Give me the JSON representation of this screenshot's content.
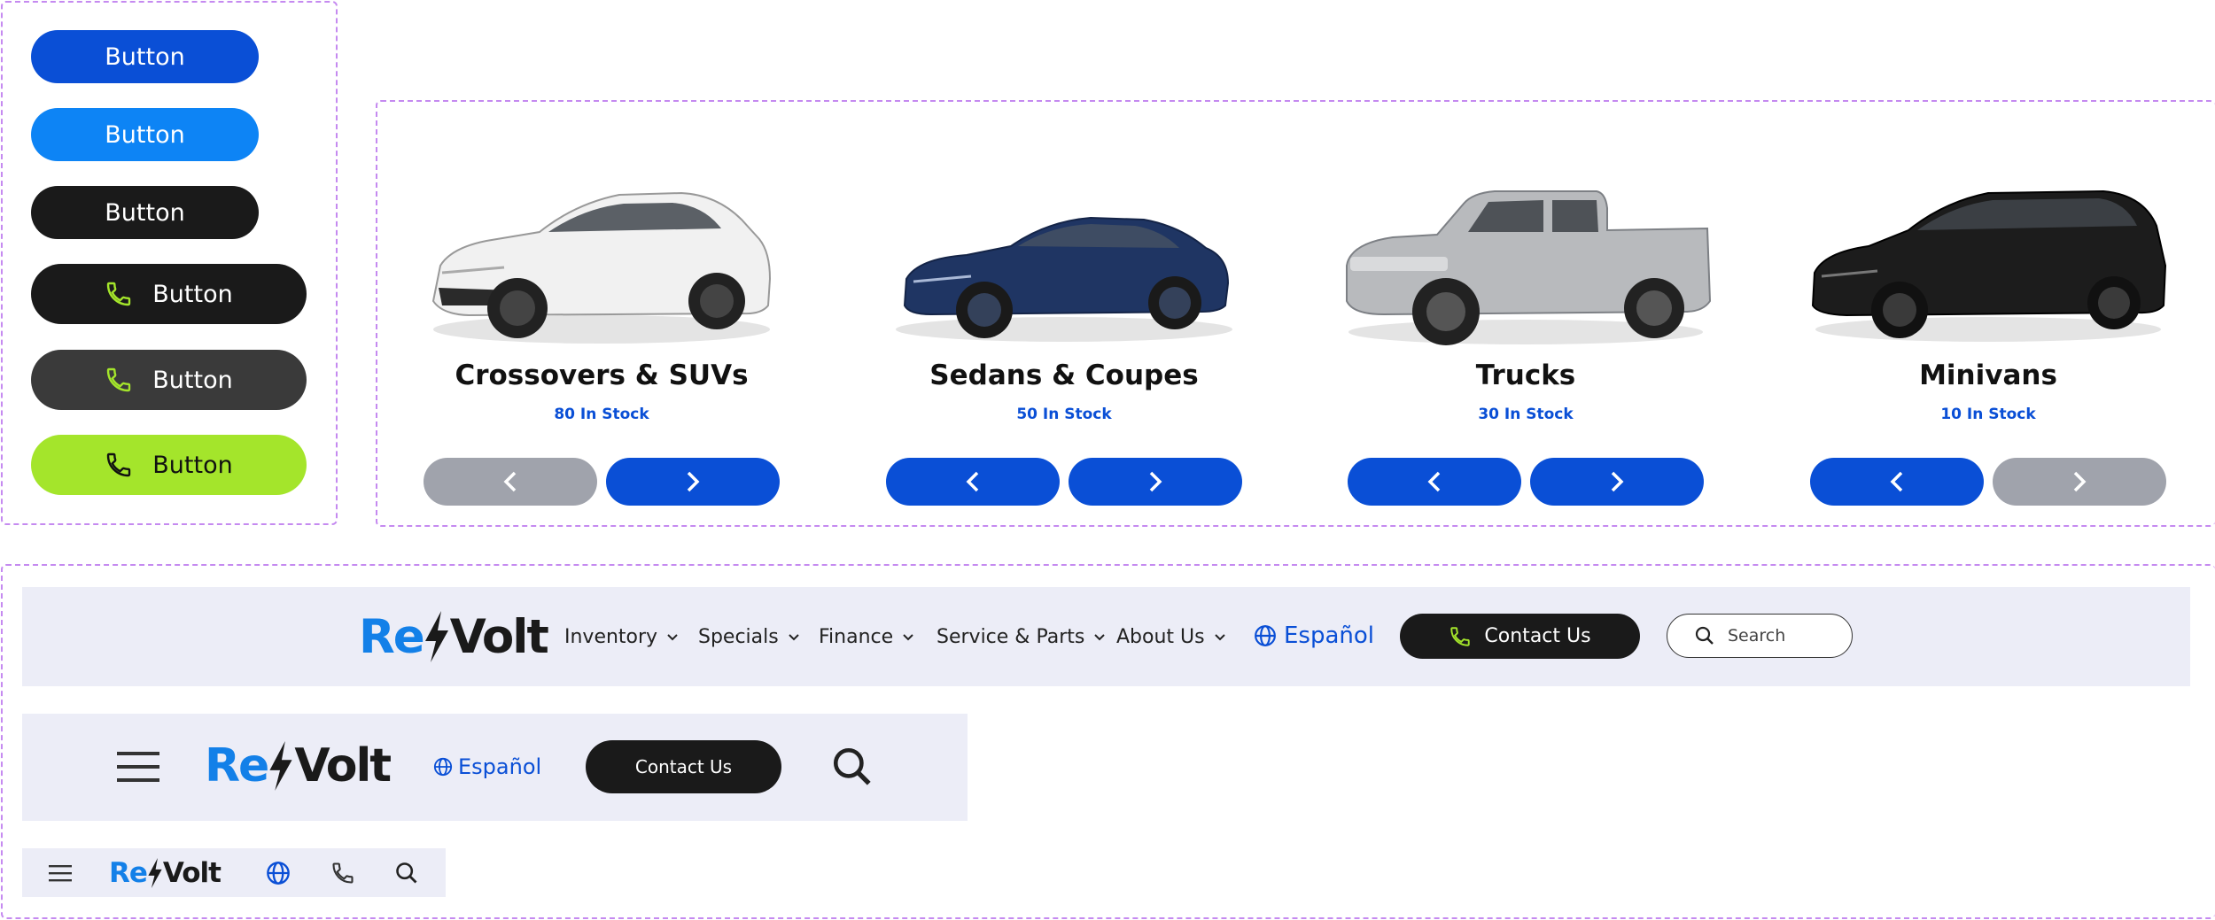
{
  "button_showcase": {
    "buttons": [
      {
        "label": "Button",
        "color": "#0a4fd6",
        "phone_icon": false
      },
      {
        "label": "Button",
        "color": "#0d84f5",
        "phone_icon": false
      },
      {
        "label": "Button",
        "color": "#1a1a1a",
        "phone_icon": false
      },
      {
        "label": "Button",
        "color": "#1a1a1a",
        "phone_icon": true
      },
      {
        "label": "Button",
        "color": "#3a3a3a",
        "phone_icon": true
      },
      {
        "label": "Button",
        "color": "#a4e52b",
        "phone_icon": true
      }
    ]
  },
  "categories": {
    "items": [
      {
        "title": "Crossovers & SUVs",
        "stock": "80 In Stock",
        "car_color": "#f1f1f1",
        "prev_enabled": false,
        "next_enabled": true
      },
      {
        "title": "Sedans & Coupes",
        "stock": "50 In Stock",
        "car_color": "#1f3563",
        "prev_enabled": true,
        "next_enabled": true
      },
      {
        "title": "Trucks",
        "stock": "30 In Stock",
        "car_color": "#b8babd",
        "prev_enabled": true,
        "next_enabled": true
      },
      {
        "title": "Minivans",
        "stock": "10 In Stock",
        "car_color": "#1c1c1c",
        "prev_enabled": true,
        "next_enabled": false
      }
    ]
  },
  "brand": {
    "logo_re": "Re",
    "logo_volt": "Volt",
    "primary": "#0a4fd6",
    "accent": "#a4e52b",
    "logo_blue": "#1380e8"
  },
  "desktop_header": {
    "nav": [
      "Inventory",
      "Specials",
      "Finance",
      "Service & Parts",
      "About Us"
    ],
    "language": "Español",
    "contact": "Contact Us",
    "search_placeholder": "Search"
  },
  "tablet_header": {
    "language": "Español",
    "contact": "Contact Us"
  },
  "icons": [
    "phone-icon",
    "chevron-left-icon",
    "chevron-right-icon",
    "chevron-down-icon",
    "globe-icon",
    "search-icon",
    "menu-icon",
    "bolt-icon"
  ]
}
